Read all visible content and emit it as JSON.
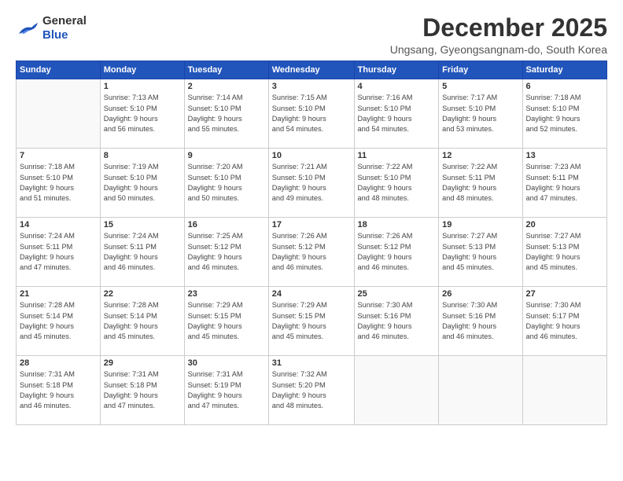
{
  "logo": {
    "general": "General",
    "blue": "Blue"
  },
  "title": "December 2025",
  "subtitle": "Ungsang, Gyeongsangnam-do, South Korea",
  "header_days": [
    "Sunday",
    "Monday",
    "Tuesday",
    "Wednesday",
    "Thursday",
    "Friday",
    "Saturday"
  ],
  "weeks": [
    [
      {
        "day": "",
        "detail": ""
      },
      {
        "day": "1",
        "detail": "Sunrise: 7:13 AM\nSunset: 5:10 PM\nDaylight: 9 hours\nand 56 minutes."
      },
      {
        "day": "2",
        "detail": "Sunrise: 7:14 AM\nSunset: 5:10 PM\nDaylight: 9 hours\nand 55 minutes."
      },
      {
        "day": "3",
        "detail": "Sunrise: 7:15 AM\nSunset: 5:10 PM\nDaylight: 9 hours\nand 54 minutes."
      },
      {
        "day": "4",
        "detail": "Sunrise: 7:16 AM\nSunset: 5:10 PM\nDaylight: 9 hours\nand 54 minutes."
      },
      {
        "day": "5",
        "detail": "Sunrise: 7:17 AM\nSunset: 5:10 PM\nDaylight: 9 hours\nand 53 minutes."
      },
      {
        "day": "6",
        "detail": "Sunrise: 7:18 AM\nSunset: 5:10 PM\nDaylight: 9 hours\nand 52 minutes."
      }
    ],
    [
      {
        "day": "7",
        "detail": "Sunrise: 7:18 AM\nSunset: 5:10 PM\nDaylight: 9 hours\nand 51 minutes."
      },
      {
        "day": "8",
        "detail": "Sunrise: 7:19 AM\nSunset: 5:10 PM\nDaylight: 9 hours\nand 50 minutes."
      },
      {
        "day": "9",
        "detail": "Sunrise: 7:20 AM\nSunset: 5:10 PM\nDaylight: 9 hours\nand 50 minutes."
      },
      {
        "day": "10",
        "detail": "Sunrise: 7:21 AM\nSunset: 5:10 PM\nDaylight: 9 hours\nand 49 minutes."
      },
      {
        "day": "11",
        "detail": "Sunrise: 7:22 AM\nSunset: 5:10 PM\nDaylight: 9 hours\nand 48 minutes."
      },
      {
        "day": "12",
        "detail": "Sunrise: 7:22 AM\nSunset: 5:11 PM\nDaylight: 9 hours\nand 48 minutes."
      },
      {
        "day": "13",
        "detail": "Sunrise: 7:23 AM\nSunset: 5:11 PM\nDaylight: 9 hours\nand 47 minutes."
      }
    ],
    [
      {
        "day": "14",
        "detail": "Sunrise: 7:24 AM\nSunset: 5:11 PM\nDaylight: 9 hours\nand 47 minutes."
      },
      {
        "day": "15",
        "detail": "Sunrise: 7:24 AM\nSunset: 5:11 PM\nDaylight: 9 hours\nand 46 minutes."
      },
      {
        "day": "16",
        "detail": "Sunrise: 7:25 AM\nSunset: 5:12 PM\nDaylight: 9 hours\nand 46 minutes."
      },
      {
        "day": "17",
        "detail": "Sunrise: 7:26 AM\nSunset: 5:12 PM\nDaylight: 9 hours\nand 46 minutes."
      },
      {
        "day": "18",
        "detail": "Sunrise: 7:26 AM\nSunset: 5:12 PM\nDaylight: 9 hours\nand 46 minutes."
      },
      {
        "day": "19",
        "detail": "Sunrise: 7:27 AM\nSunset: 5:13 PM\nDaylight: 9 hours\nand 45 minutes."
      },
      {
        "day": "20",
        "detail": "Sunrise: 7:27 AM\nSunset: 5:13 PM\nDaylight: 9 hours\nand 45 minutes."
      }
    ],
    [
      {
        "day": "21",
        "detail": "Sunrise: 7:28 AM\nSunset: 5:14 PM\nDaylight: 9 hours\nand 45 minutes."
      },
      {
        "day": "22",
        "detail": "Sunrise: 7:28 AM\nSunset: 5:14 PM\nDaylight: 9 hours\nand 45 minutes."
      },
      {
        "day": "23",
        "detail": "Sunrise: 7:29 AM\nSunset: 5:15 PM\nDaylight: 9 hours\nand 45 minutes."
      },
      {
        "day": "24",
        "detail": "Sunrise: 7:29 AM\nSunset: 5:15 PM\nDaylight: 9 hours\nand 45 minutes."
      },
      {
        "day": "25",
        "detail": "Sunrise: 7:30 AM\nSunset: 5:16 PM\nDaylight: 9 hours\nand 46 minutes."
      },
      {
        "day": "26",
        "detail": "Sunrise: 7:30 AM\nSunset: 5:16 PM\nDaylight: 9 hours\nand 46 minutes."
      },
      {
        "day": "27",
        "detail": "Sunrise: 7:30 AM\nSunset: 5:17 PM\nDaylight: 9 hours\nand 46 minutes."
      }
    ],
    [
      {
        "day": "28",
        "detail": "Sunrise: 7:31 AM\nSunset: 5:18 PM\nDaylight: 9 hours\nand 46 minutes."
      },
      {
        "day": "29",
        "detail": "Sunrise: 7:31 AM\nSunset: 5:18 PM\nDaylight: 9 hours\nand 47 minutes."
      },
      {
        "day": "30",
        "detail": "Sunrise: 7:31 AM\nSunset: 5:19 PM\nDaylight: 9 hours\nand 47 minutes."
      },
      {
        "day": "31",
        "detail": "Sunrise: 7:32 AM\nSunset: 5:20 PM\nDaylight: 9 hours\nand 48 minutes."
      },
      {
        "day": "",
        "detail": ""
      },
      {
        "day": "",
        "detail": ""
      },
      {
        "day": "",
        "detail": ""
      }
    ]
  ]
}
